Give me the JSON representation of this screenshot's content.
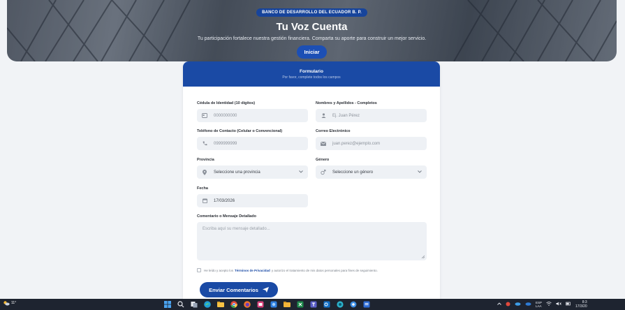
{
  "hero": {
    "badge": "BANCO DE DESARROLLO DEL ECUADOR B. P.",
    "title": "Tu Voz Cuenta",
    "subtitle": "Tu participación fortalece nuestra gestión financiera. Comparta su aporte para construir un mejor servicio.",
    "cta": "Iniciar"
  },
  "form": {
    "title": "Formulario",
    "subtitle": "Por favor, complete todos los campos",
    "cedula": {
      "label": "Cédula de Identidad (10 dígitos)",
      "placeholder": "0000000000",
      "icon": "id-card-icon"
    },
    "nombre": {
      "label": "Nombres y Apellidos - Completos",
      "placeholder": "Ej. Juan Pérez",
      "icon": "user-icon"
    },
    "telefono": {
      "label": "Teléfono de Contacto (Celular o Convencional)",
      "placeholder": "0999999999",
      "icon": "phone-icon"
    },
    "correo": {
      "label": "Correo Electrónico",
      "placeholder": "juan.perez@ejemplo.com",
      "icon": "envelope-icon"
    },
    "provincia": {
      "label": "Provincia",
      "value": "Seleccione una provincia",
      "icon": "map-pin-icon"
    },
    "genero": {
      "label": "Género",
      "value": "Seleccione un género",
      "icon": "gender-icon"
    },
    "fecha": {
      "label": "Fecha",
      "value": "17/03/2026",
      "icon": "calendar-icon"
    },
    "comentario": {
      "label": "Comentario o Mensaje Detallado",
      "placeholder": "Escriba aquí su mensaje detallado..."
    },
    "consent": {
      "before": "He leído y acepto los",
      "link": "Términos de Privacidad",
      "after": "y autorizo el tratamiento de mis datos personales para fines de seguimiento."
    },
    "submit": "Enviar Comentarios"
  },
  "taskbar": {
    "weather": "11°",
    "language": "ESP",
    "language_sub": "LAA",
    "time": "8:3",
    "date": "17/3/20"
  },
  "colors": {
    "primary": "#1a4aa5",
    "field_bg": "#eef1f5",
    "taskbar": "#1e2430"
  }
}
